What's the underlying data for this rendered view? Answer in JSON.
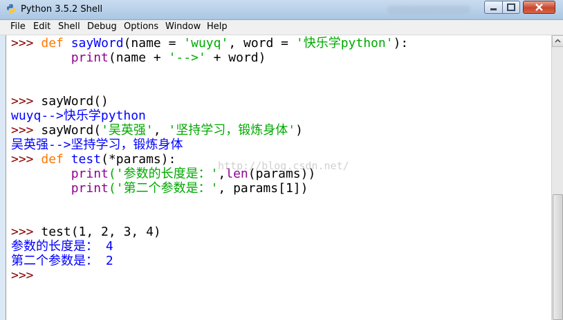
{
  "window": {
    "title": "Python 3.5.2 Shell",
    "icon": "python-icon",
    "controls": [
      "minimize-icon",
      "maximize-icon",
      "close-icon"
    ]
  },
  "menu": {
    "items": [
      "File",
      "Edit",
      "Shell",
      "Debug",
      "Options",
      "Window",
      "Help"
    ]
  },
  "shell": {
    "prompt": ">>>",
    "lines": {
      "l1": {
        "kw": "def",
        "name": "sayWord",
        "args": "(name = ",
        "s1": "'wuyq'",
        "mid": ", word = ",
        "s2": "'快乐学python'",
        "tail": "):"
      },
      "l2": {
        "bi": "print",
        "a": "(name + ",
        "s": "'-->'",
        "b": " + word)"
      },
      "l3": {
        "code": "sayWord()"
      },
      "l4": {
        "out": "wuyq-->快乐学python"
      },
      "l5": {
        "a": "sayWord(",
        "s1": "'吴英强'",
        "mid": ", ",
        "s2": "'坚持学习，锻炼身体'",
        "b": ")"
      },
      "l6": {
        "out": "吴英强-->坚持学习，锻炼身体"
      },
      "l7": {
        "kw": "def",
        "name": "test",
        "args": "(*params):"
      },
      "l8": {
        "bi": "print",
        "s": "('参数的长度是：'",
        "mid": ",",
        "bi2": "len",
        "b": "(params))"
      },
      "l9": {
        "bi": "print",
        "s": "('第二个参数是：'",
        "b": ", params[1])"
      },
      "l10": {
        "code": "test(1, 2, 3, 4)"
      },
      "l11": {
        "out": "参数的长度是： 4"
      },
      "l12": {
        "out": "第二个参数是： 2"
      }
    }
  },
  "watermark": "http://blog.csdn.net/",
  "colors": {
    "keyword": "#ff7700",
    "builtin": "#900090",
    "definition": "#0000ff",
    "string": "#00aa00",
    "prompt": "#8b0000",
    "stdout": "#0000ff"
  }
}
